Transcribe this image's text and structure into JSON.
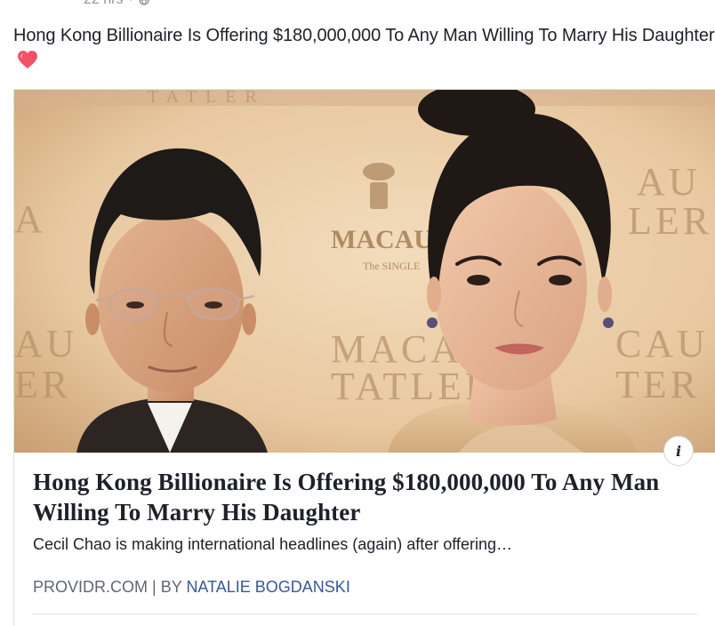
{
  "post": {
    "timestamp": "22 hrs",
    "separator": "·",
    "privacy_icon": "globe-icon",
    "text": "Hong Kong Billionaire Is Offering $180,000,000 To Any Man Willing To Marry His Daughter",
    "emoji_icon": "heart-icon"
  },
  "link_card": {
    "image_signage": {
      "tatler_top": "TATLER",
      "brand_mid": "MACAU",
      "brand_small": "The SINGLE",
      "macau_big": "MACAU",
      "tatler_big": "TATLER",
      "left_a": "A",
      "left_au": "AU",
      "left_er": "ER",
      "right_au": "AU",
      "right_ler": "LER",
      "right_cau": "CAU",
      "right_ter": "TER"
    },
    "info_label": "i",
    "title": "Hong Kong Billionaire Is Offering $180,000,000 To Any Man Willing To Marry His Daughter",
    "description": "Cecil Chao is making international headlines (again) after offering…",
    "domain": "PROVIDR.COM",
    "divider": "|",
    "by_prefix": "BY",
    "author": "NATALIE BOGDANSKI"
  },
  "colors": {
    "text_primary": "#1d2129",
    "meta_gray": "#90949c",
    "source_gray": "#606770",
    "author_blue": "#385898",
    "heart_pink": "#f25268",
    "backdrop": "#e7c9a4"
  }
}
